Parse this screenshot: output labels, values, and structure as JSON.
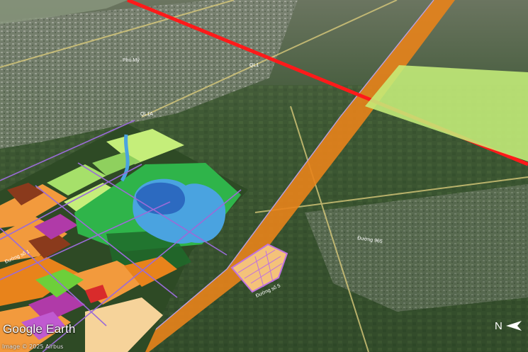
{
  "brand": {
    "wordmark": "Google Earth"
  },
  "attribution": "Image © 2025 Airbus",
  "compass": {
    "label": "N"
  },
  "map_labels": {
    "road_qlA": "QL1A",
    "road_ql": "QL1",
    "town": "Phú Mỹ",
    "street_left": "Đường số 1",
    "street_bottom": "Đường số 5",
    "street_right": "Đường 965"
  },
  "colors": {
    "expressway": "#e8831b",
    "rail_line": "#ff1a1a",
    "green_parcel": "#c5ee7a",
    "lake": "#4aa3e0",
    "park": "#2fb44a",
    "residential": "#f29a3d",
    "road_outline": "#9a6bd8"
  }
}
